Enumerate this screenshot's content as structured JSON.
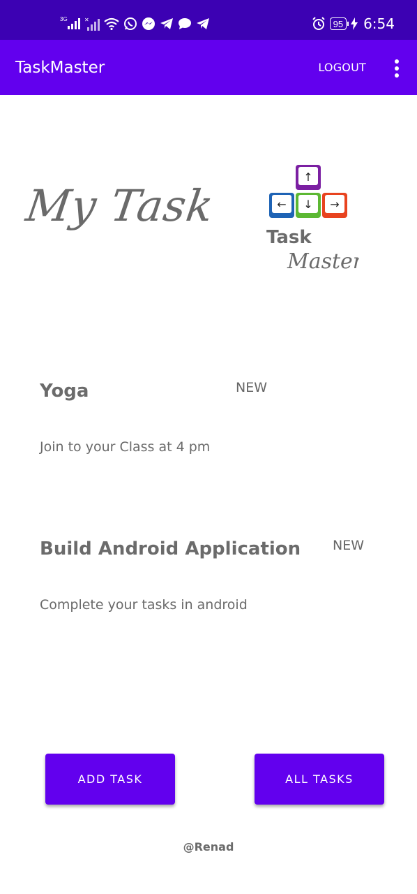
{
  "status_bar": {
    "network_label": "3G",
    "battery": "95",
    "time": "6:54",
    "left_icons": [
      "signal-icon",
      "signal-x-icon",
      "wifi-icon",
      "whatsapp-icon",
      "messenger-icon",
      "telegram-icon",
      "chat-icon",
      "telegram-icon"
    ],
    "right_icons": [
      "alarm-icon",
      "battery-icon",
      "charging-icon"
    ]
  },
  "app_bar": {
    "title": "TaskMaster",
    "logout_label": "LOGOUT",
    "menu_icon": "more-vert-icon"
  },
  "header": {
    "heading": "My Task",
    "logo_text_top": "Task",
    "logo_text_bottom": "Master",
    "logo_keys": [
      "↑",
      "←",
      "↓",
      "→"
    ]
  },
  "tasks": [
    {
      "title": "Yoga",
      "state": "NEW",
      "body": "Join to your Class at 4 pm"
    },
    {
      "title": "Build Android Application",
      "state": "NEW",
      "body": "Complete your tasks in android"
    }
  ],
  "buttons": {
    "add_task": "ADD TASK",
    "all_tasks": "ALL TASKS"
  },
  "footer": {
    "credit": "@Renad"
  },
  "colors": {
    "status_bar": "#3c01b3",
    "app_bar": "#6200ee",
    "button": "#6200ee"
  }
}
